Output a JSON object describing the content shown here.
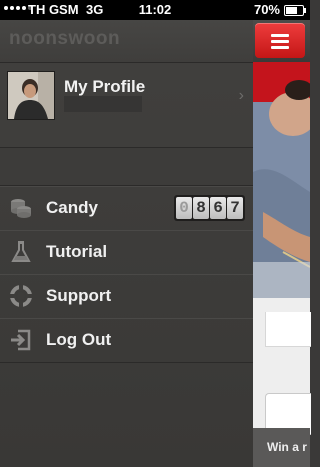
{
  "status_bar": {
    "carrier": "TH GSM",
    "network": "3G",
    "time": "11:02",
    "battery": "70%",
    "battery_level": 0.7
  },
  "app": {
    "logo": "noonswoon"
  },
  "profile": {
    "name": "My Profile",
    "chevron_icon": "chevron-right-icon"
  },
  "menu": {
    "items": [
      {
        "label": "Candy",
        "icon": "coins-icon"
      },
      {
        "label": "Tutorial",
        "icon": "flask-icon"
      },
      {
        "label": "Support",
        "icon": "lifebuoy-icon"
      },
      {
        "label": "Log Out",
        "icon": "logout-icon"
      }
    ],
    "candy_counter": [
      "0",
      "8",
      "6",
      "7"
    ]
  },
  "content": {
    "menu_button_icon": "hamburger-icon",
    "banner_text": "Win a r",
    "accent_color": "#d92020"
  }
}
